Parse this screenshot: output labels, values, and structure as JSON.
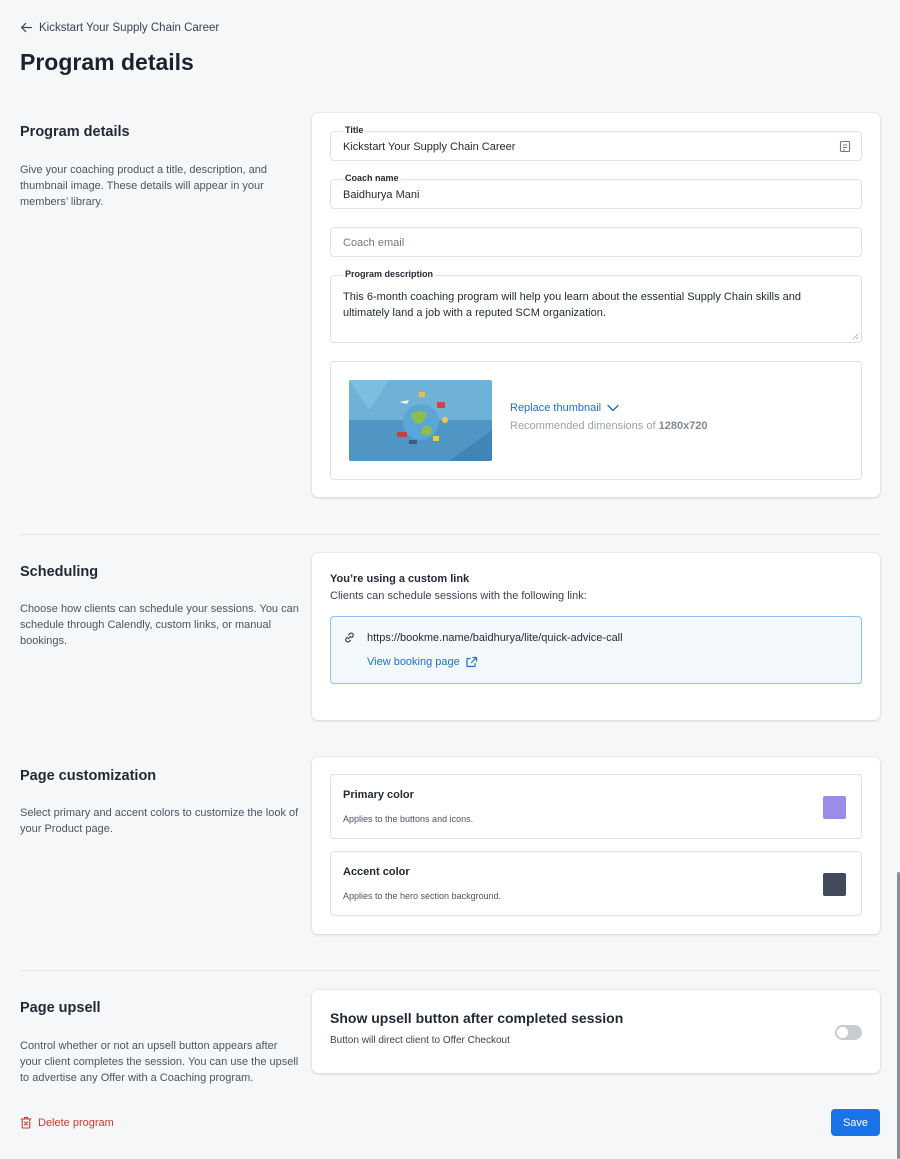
{
  "header": {
    "back_label": "Kickstart Your Supply Chain Career",
    "page_title": "Program details"
  },
  "program_details": {
    "title": "Program details",
    "description": "Give your coaching product a title, description, and thumbnail image. These details will appear in your members’ library.",
    "fields": {
      "title_label": "Title",
      "title_value": "Kickstart Your Supply Chain Career",
      "coach_name_label": "Coach name",
      "coach_name_value": "Baidhurya Mani",
      "coach_email_placeholder": "Coach email",
      "description_label": "Program description",
      "description_value": "This 6-month coaching program will help you learn about the essential Supply Chain skills and ultimately land a job with a reputed SCM organization."
    },
    "thumbnail": {
      "replace_label": "Replace thumbnail",
      "recommended_prefix": "Recommended dimensions of",
      "recommended_value": "1280x720"
    }
  },
  "scheduling": {
    "title": "Scheduling",
    "description": "Choose how clients can schedule your sessions. You can schedule through Calendly, custom links, or manual bookings.",
    "card_title": "You’re using a custom link",
    "card_subtitle": "Clients can schedule sessions with the following link:",
    "link_url": "https://bookme.name/baidhurya/lite/quick-advice-call",
    "view_booking_label": "View booking page"
  },
  "customization": {
    "title": "Page customization",
    "description": "Select primary and accent colors to customize the look of your Product page.",
    "primary_title": "Primary color",
    "primary_desc": "Applies to the buttons and icons.",
    "primary_color": "#9b8ce8",
    "accent_title": "Accent color",
    "accent_desc": "Applies to the hero section background.",
    "accent_color": "#414b5b"
  },
  "upsell": {
    "title": "Page upsell",
    "description": "Control whether or not an upsell button appears after your client completes the session. You can use the upsell to advertise any Offer with a Coaching program.",
    "card_title": "Show upsell button after completed session",
    "card_subtitle": "Button will direct client to Offer Checkout",
    "toggle_on": false
  },
  "footer": {
    "delete_label": "Delete program",
    "save_label": "Save"
  }
}
